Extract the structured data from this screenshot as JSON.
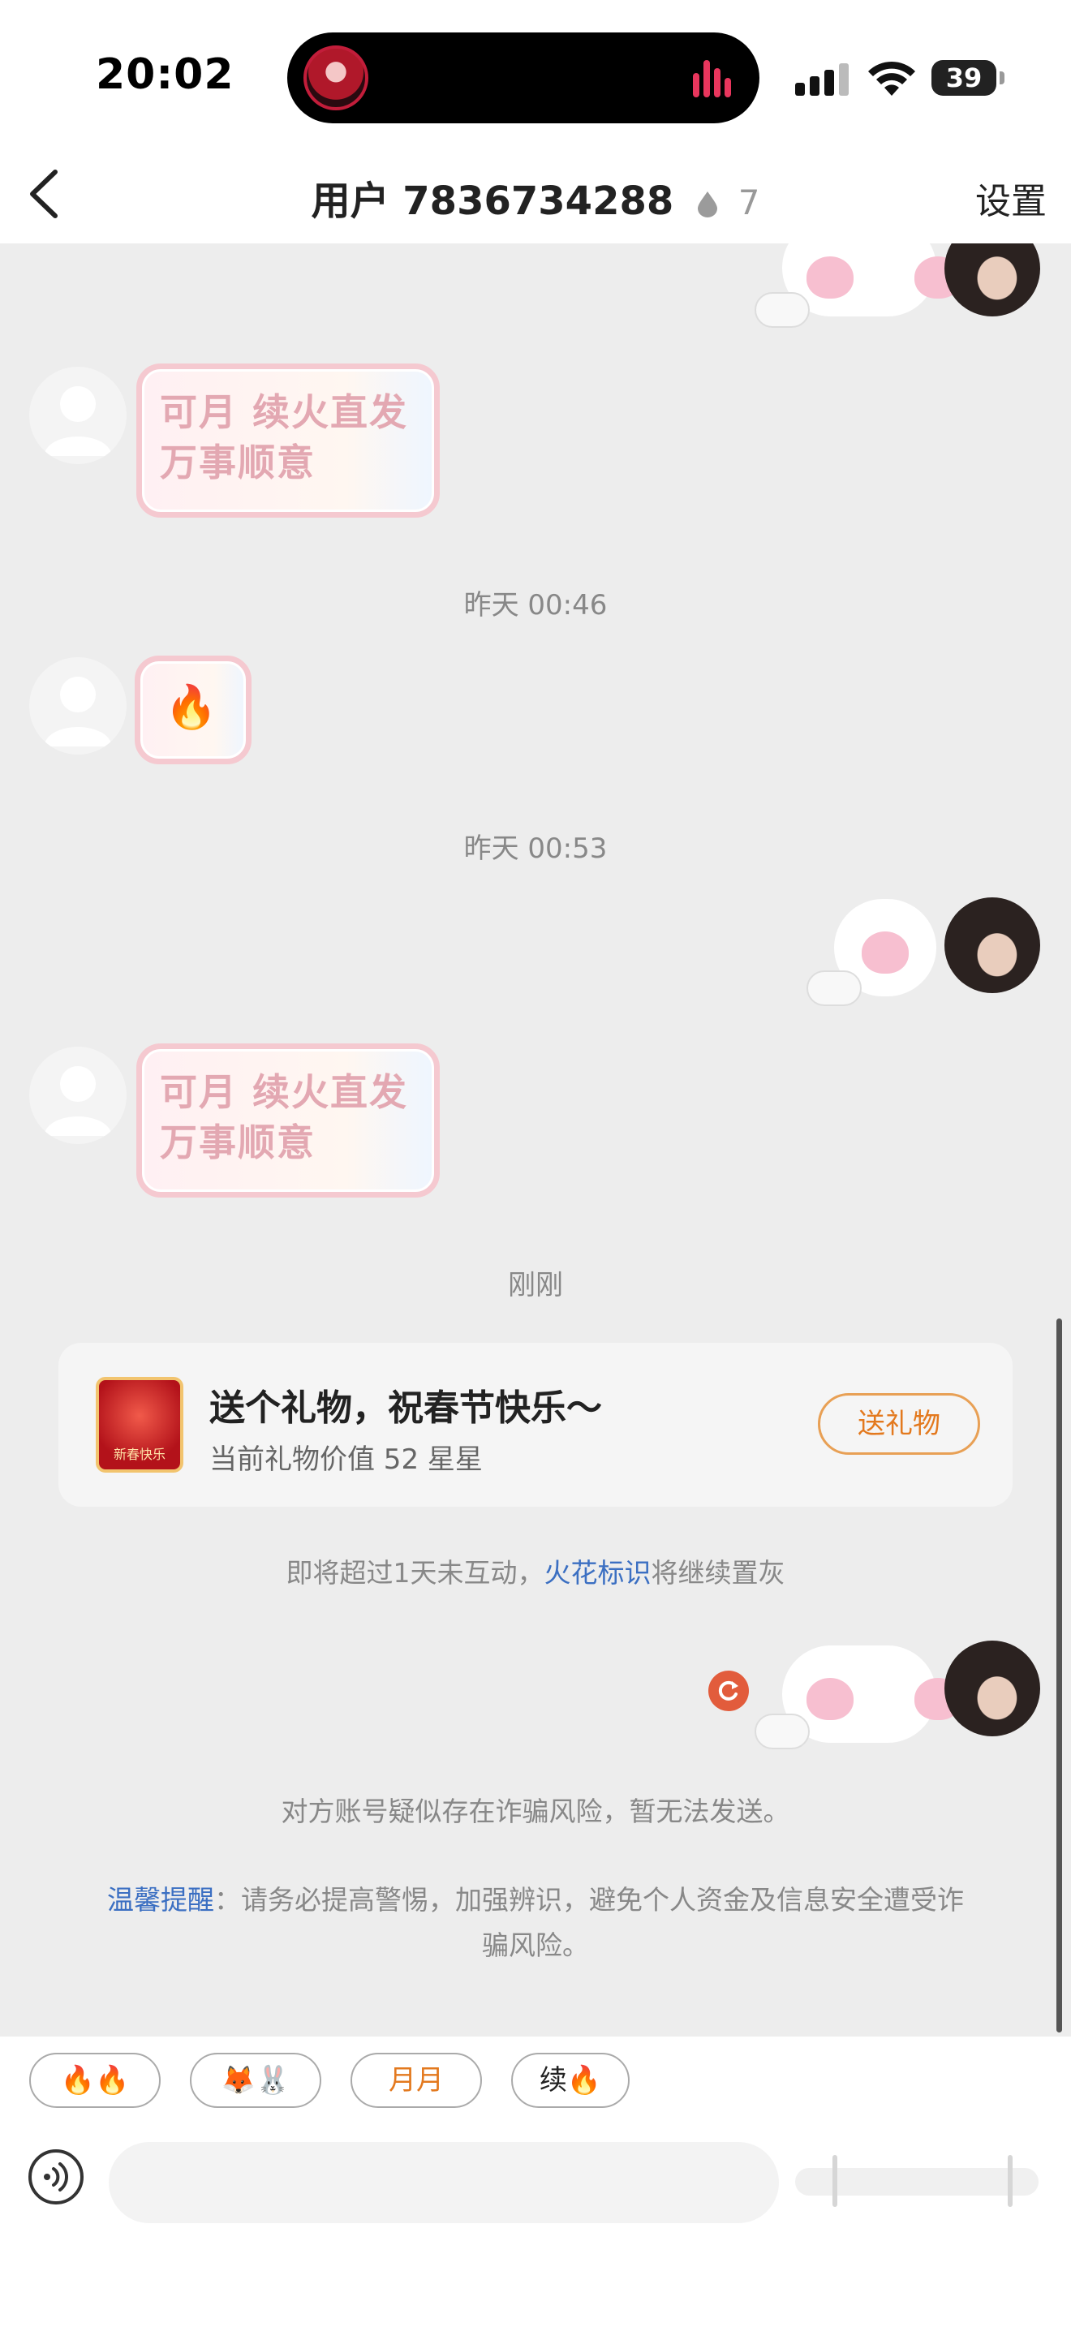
{
  "status_bar": {
    "time": "20:02",
    "battery": "39"
  },
  "nav": {
    "title": "用户 7836734288",
    "spark_count": "7",
    "settings_label": "设置"
  },
  "messages": {
    "stamp_text_1": "可月 续火直发\n万事顺意",
    "timestamp_1": "昨天 00:46",
    "fire_emoji": "🔥",
    "timestamp_2": "昨天 00:53",
    "stamp_text_2": "可月 续火直发\n万事顺意",
    "timestamp_3": "刚刚"
  },
  "gift_card": {
    "title": "送个礼物，祝春节快乐～",
    "subtitle": "当前礼物价值 52 星星",
    "button_label": "送礼物",
    "icon_text": "新春快乐"
  },
  "spark_notice": {
    "prefix": "即将超过1天未互动，",
    "link": "火花标识",
    "suffix": "将继续置灰"
  },
  "fraud_notice": {
    "line": "对方账号疑似存在诈骗风险，暂无法发送。",
    "reminder_label": "温馨提醒",
    "reminder_text": "：请务必提高警惕，加强辨识，避免个人资金及信息安全遭受诈骗风险。"
  },
  "quick_replies": [
    {
      "label": "🔥🔥"
    },
    {
      "label": "🦊🐰"
    },
    {
      "label": "月月"
    },
    {
      "label": "续🔥"
    }
  ],
  "input": {
    "placeholder": ""
  },
  "colors": {
    "accent_orange": "#e3791e",
    "link_blue": "#3b6fc2",
    "failed_red": "#e25c3c"
  }
}
